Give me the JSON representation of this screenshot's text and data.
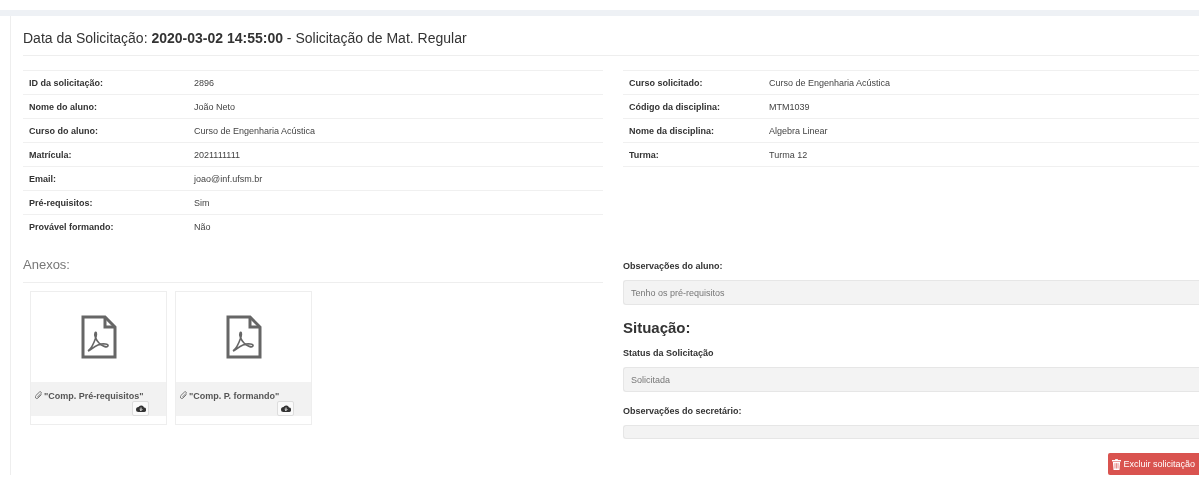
{
  "title": {
    "prefix": "Data da Solicitação: ",
    "date": "2020-03-02 14:55:00",
    "suffix": " - Solicitação de Mat. Regular"
  },
  "student_table": [
    {
      "label": "ID da solicitação:",
      "value": "2896"
    },
    {
      "label": "Nome do aluno:",
      "value": "João Neto"
    },
    {
      "label": "Curso do aluno:",
      "value": "Curso de Engenharia Acústica"
    },
    {
      "label": "Matrícula:",
      "value": "2021111111"
    },
    {
      "label": "Email:",
      "value": "joao@inf.ufsm.br"
    },
    {
      "label": "Pré-requisitos:",
      "value": "Sim"
    },
    {
      "label": "Provável formando:",
      "value": "Não"
    }
  ],
  "course_table": [
    {
      "label": "Curso solicitado:",
      "value": "Curso de Engenharia Acústica"
    },
    {
      "label": "Código da disciplina:",
      "value": "MTM1039"
    },
    {
      "label": "Nome da disciplina:",
      "value": "Algebra Linear"
    },
    {
      "label": "Turma:",
      "value": "Turma 12"
    }
  ],
  "attachments_heading": "Anexos:",
  "attachments": [
    {
      "name": "\"Comp. Pré-requisitos\""
    },
    {
      "name": "\"Comp. P. formando\""
    }
  ],
  "student_notes": {
    "label": "Observações do aluno:",
    "value": "Tenho os pré-requisitos"
  },
  "situation_heading": "Situação:",
  "status": {
    "label": "Status da Solicitação",
    "value": "Solicitada"
  },
  "secretary_notes": {
    "label": "Observações do secretário:"
  },
  "delete_button": "Excluir solicitação"
}
